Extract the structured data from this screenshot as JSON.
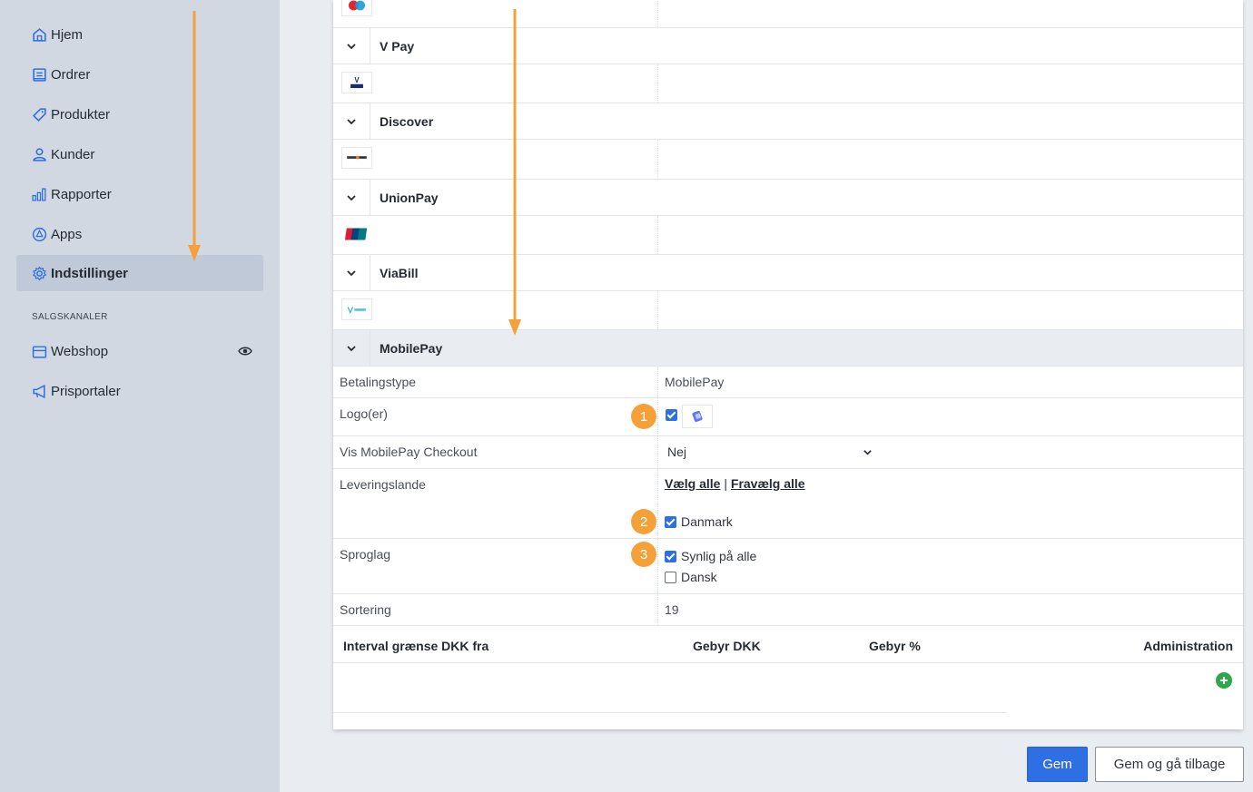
{
  "sidebar": {
    "items": [
      {
        "label": "Hjem",
        "icon": "home-icon"
      },
      {
        "label": "Ordrer",
        "icon": "orders-icon"
      },
      {
        "label": "Produkter",
        "icon": "tag-icon"
      },
      {
        "label": "Kunder",
        "icon": "user-icon"
      },
      {
        "label": "Rapporter",
        "icon": "bar-chart-icon"
      },
      {
        "label": "Apps",
        "icon": "apps-icon"
      },
      {
        "label": "Indstillinger",
        "icon": "gear-icon",
        "active": true
      }
    ],
    "section_label": "SALGSKANALER",
    "channels": [
      {
        "label": "Webshop",
        "icon": "store-icon"
      },
      {
        "label": "Prisportaler",
        "icon": "megaphone-icon"
      }
    ]
  },
  "payments": {
    "cards": [
      {
        "name": "V Pay",
        "logo": "VPAY"
      },
      {
        "name": "Discover",
        "logo": "DISCOVER"
      },
      {
        "name": "UnionPay",
        "logo": "UnionPay"
      },
      {
        "name": "ViaBill",
        "logo": "VIABILL"
      }
    ],
    "open_card": {
      "name": "MobilePay",
      "fields": {
        "payment_type_label": "Betalingstype",
        "payment_type_value": "MobilePay",
        "logo_label": "Logo(er)",
        "checkout_label": "Vis MobilePay Checkout",
        "checkout_value": "Nej",
        "countries_label": "Leveringslande",
        "select_all": "Vælg alle",
        "separator": "|",
        "deselect_all": "Fravælg alle",
        "country_denmark": "Danmark",
        "languages_label": "Sproglag",
        "lang_visible_all": "Synlig på alle",
        "lang_danish": "Dansk",
        "sorting_label": "Sortering",
        "sorting_value": "19"
      },
      "fee_table": {
        "columns": [
          "Interval grænse DKK fra",
          "Gebyr DKK",
          "Gebyr %",
          "Administration"
        ]
      }
    }
  },
  "badges": [
    "1",
    "2",
    "3"
  ],
  "actions": {
    "save": "Gem",
    "save_back": "Gem og gå tilbage"
  },
  "colors": {
    "accent": "#2f6fe4",
    "badge": "#f4a13a",
    "sidebar_bg": "#d2d8e1",
    "arrow": "#f4a13a"
  }
}
